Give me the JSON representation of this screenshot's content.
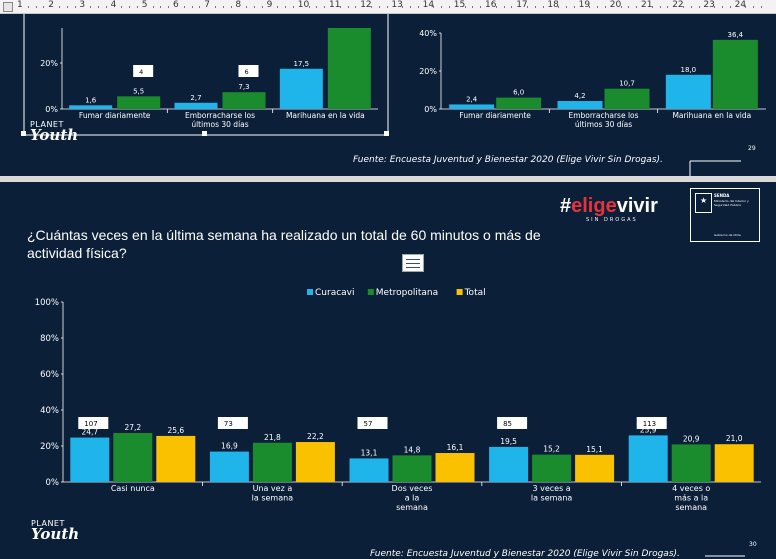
{
  "ruler": {
    "labels": [
      "1",
      "2",
      "3",
      "4",
      "5",
      "6",
      "7",
      "8",
      "9",
      "10",
      "11",
      "12",
      "13",
      "14",
      "15",
      "16",
      "17",
      "18",
      "19",
      "20",
      "21",
      "22",
      "23",
      "24"
    ]
  },
  "colors": {
    "background": "#0c1f38",
    "curacavi": "#1fb4ea",
    "metropolitana": "#1a8c2e",
    "total": "#f9c100",
    "brand_red": "#e5333c"
  },
  "slide29": {
    "footnote": "Fuente: Encuesta Juventud y Bienestar 2020 (Elige Vivir Sin Drogas).",
    "page_number": "29",
    "logo_top": "PLANET",
    "logo_bottom": "Youth",
    "chart_left": {
      "y_ticks": [
        "0%",
        "20%"
      ],
      "categories": [
        "Fumar diariamente",
        "Emborracharse los últimos 30 días",
        "Marihuana en la vida"
      ],
      "counts": [
        "4",
        "6"
      ]
    },
    "chart_right": {
      "y_ticks": [
        "0%",
        "20%",
        "40%"
      ],
      "categories": [
        "Fumar diariamente",
        "Emborracharse los últimos 30 días",
        "Marihuana en la vida"
      ]
    }
  },
  "slide30": {
    "question": "¿Cuántas veces en la última semana ha realizado un total de 60 minutos o más de actividad física?",
    "brand_hash": "#",
    "brand_elige": "elige",
    "brand_vivir": "vivir",
    "brand_sub": "SIN DROGAS",
    "gov_title": "SENDA",
    "gov_subtitle": "Ministerio del Interior y Seguridad Pública",
    "gov_footer": "Gobierno de Chile",
    "footnote": "Fuente: Encuesta Juventud y Bienestar 2020 (Elige Vivir Sin Drogas).",
    "page_number": "30",
    "logo_top": "PLANET",
    "logo_bottom": "Youth"
  },
  "chart_data": [
    {
      "type": "bar",
      "categories": [
        "Fumar diariamente",
        "Emborracharse los últimos 30 días",
        "Marihuana en la vida"
      ],
      "series": [
        {
          "values": [
            1.6,
            2.7,
            17.5
          ]
        },
        {
          "values": [
            5.5,
            7.3,
            36.0
          ]
        }
      ],
      "data_labels": [
        [
          "1,6",
          "2,7",
          "17,5"
        ],
        [
          "5,5",
          "7,3",
          ""
        ]
      ],
      "count_labels": [
        "4",
        "6",
        ""
      ],
      "y_ticks": [
        "0%",
        "20%"
      ],
      "ylim": [
        0,
        40
      ]
    },
    {
      "type": "bar",
      "categories": [
        "Fumar diariamente",
        "Emborracharse los últimos 30 días",
        "Marihuana en la vida"
      ],
      "series": [
        {
          "values": [
            2.4,
            4.2,
            18.0
          ]
        },
        {
          "values": [
            6.0,
            10.7,
            36.4
          ]
        }
      ],
      "data_labels": [
        [
          "2,4",
          "4,2",
          "18,0"
        ],
        [
          "6,0",
          "10,7",
          "36,4"
        ]
      ],
      "y_ticks": [
        "0%",
        "20%",
        "40%"
      ],
      "ylim": [
        0,
        40
      ]
    },
    {
      "type": "bar",
      "categories": [
        "Casi nunca",
        "Una vez a la semana",
        "Dos veces a la semana",
        "3 veces a la semana",
        "4 veces o más a la semana"
      ],
      "series": [
        {
          "name": "Curacavi",
          "values": [
            24.7,
            16.9,
            13.1,
            19.5,
            25.9
          ]
        },
        {
          "name": "Metropolitana",
          "values": [
            27.2,
            21.8,
            14.8,
            15.2,
            20.9
          ]
        },
        {
          "name": "Total",
          "values": [
            25.6,
            22.2,
            16.1,
            15.1,
            21.0
          ]
        }
      ],
      "data_labels": [
        [
          "24,7",
          "16,9",
          "13,1",
          "19,5",
          "25,9"
        ],
        [
          "27,2",
          "21,8",
          "14,8",
          "15,2",
          "20,9"
        ],
        [
          "25,6",
          "22,2",
          "16,1",
          "15,1",
          "21,0"
        ]
      ],
      "count_labels": [
        "107",
        "73",
        "57",
        "85",
        "113"
      ],
      "y_ticks": [
        "0%",
        "20%",
        "40%",
        "60%",
        "80%",
        "100%"
      ],
      "ylim": [
        0,
        100
      ],
      "legend_position": "top"
    }
  ]
}
